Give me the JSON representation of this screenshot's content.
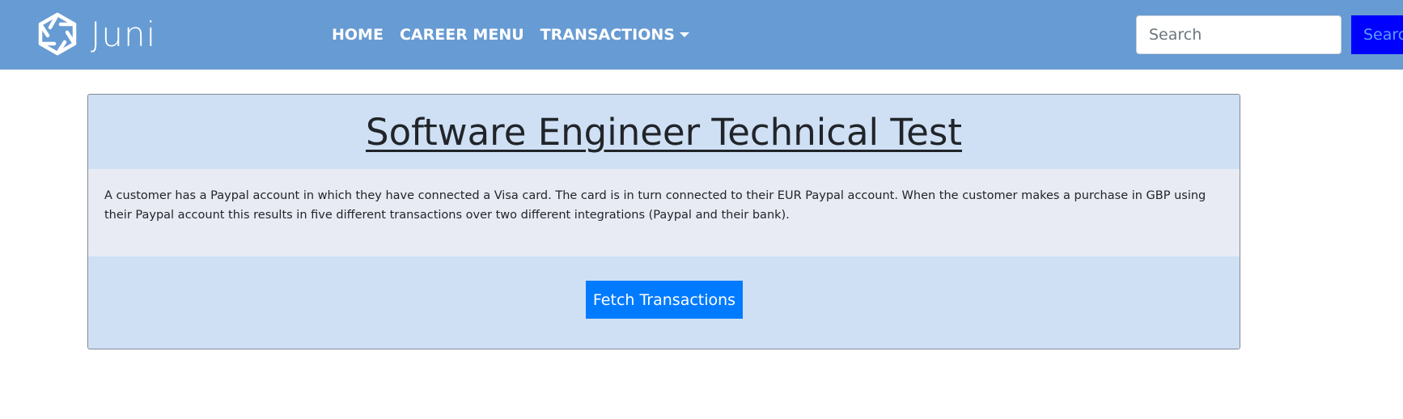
{
  "navbar": {
    "brand_name": "Juni",
    "links": [
      {
        "label": "HOME"
      },
      {
        "label": "CAREER MENU"
      },
      {
        "label": "TRANSACTIONS"
      }
    ],
    "search": {
      "placeholder": "Search",
      "value": "",
      "button_label": "Search"
    },
    "colors": {
      "background": "#679bd3",
      "search_button": "#0000ff"
    }
  },
  "card": {
    "title": "Software Engineer Technical Test",
    "description": "A customer has a Paypal account in which they have connected a Visa card. The card is in turn connected to their EUR Paypal account. When the customer makes a purchase in GBP using their Paypal account this results in five different transactions over two different integrations (Paypal and their bank).",
    "button_label": "Fetch Transactions",
    "colors": {
      "header": "#cfe0f5",
      "body": "#e8ebf3",
      "button": "#007bff"
    }
  },
  "icons": {
    "brand_logo": "juni-logo-icon",
    "dropdown": "caret-down-icon"
  }
}
